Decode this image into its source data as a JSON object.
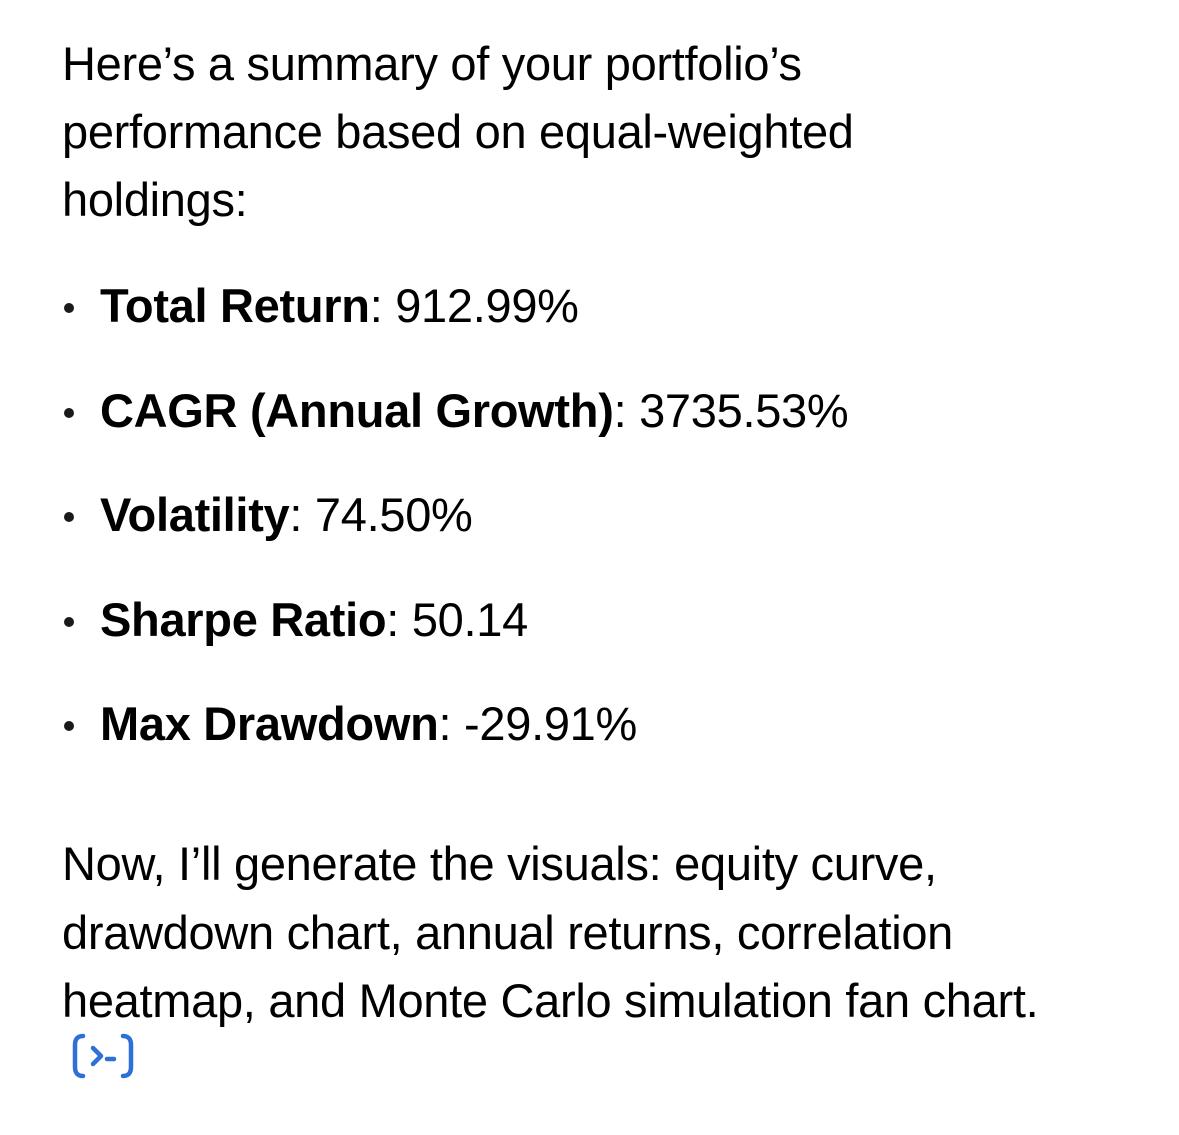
{
  "message": {
    "intro": "Here’s a summary of your portfolio’s performance based on equal-weighted holdings:",
    "metrics": [
      {
        "label": "Total Return",
        "value": "912.99%"
      },
      {
        "label": "CAGR (Annual Growth)",
        "value": "3735.53%"
      },
      {
        "label": "Volatility",
        "value": "74.50%"
      },
      {
        "label": "Sharpe Ratio",
        "value": "50.14"
      },
      {
        "label": "Max Drawdown",
        "value": "-29.91%"
      }
    ],
    "outro": "Now, I’ll generate the visuals: equity curve, drawdown chart, annual returns, correlation heatmap, and Monte Carlo simulation fan chart.",
    "code_icon": "code-interpreter-icon",
    "accent_color": "#2f6fd8"
  }
}
